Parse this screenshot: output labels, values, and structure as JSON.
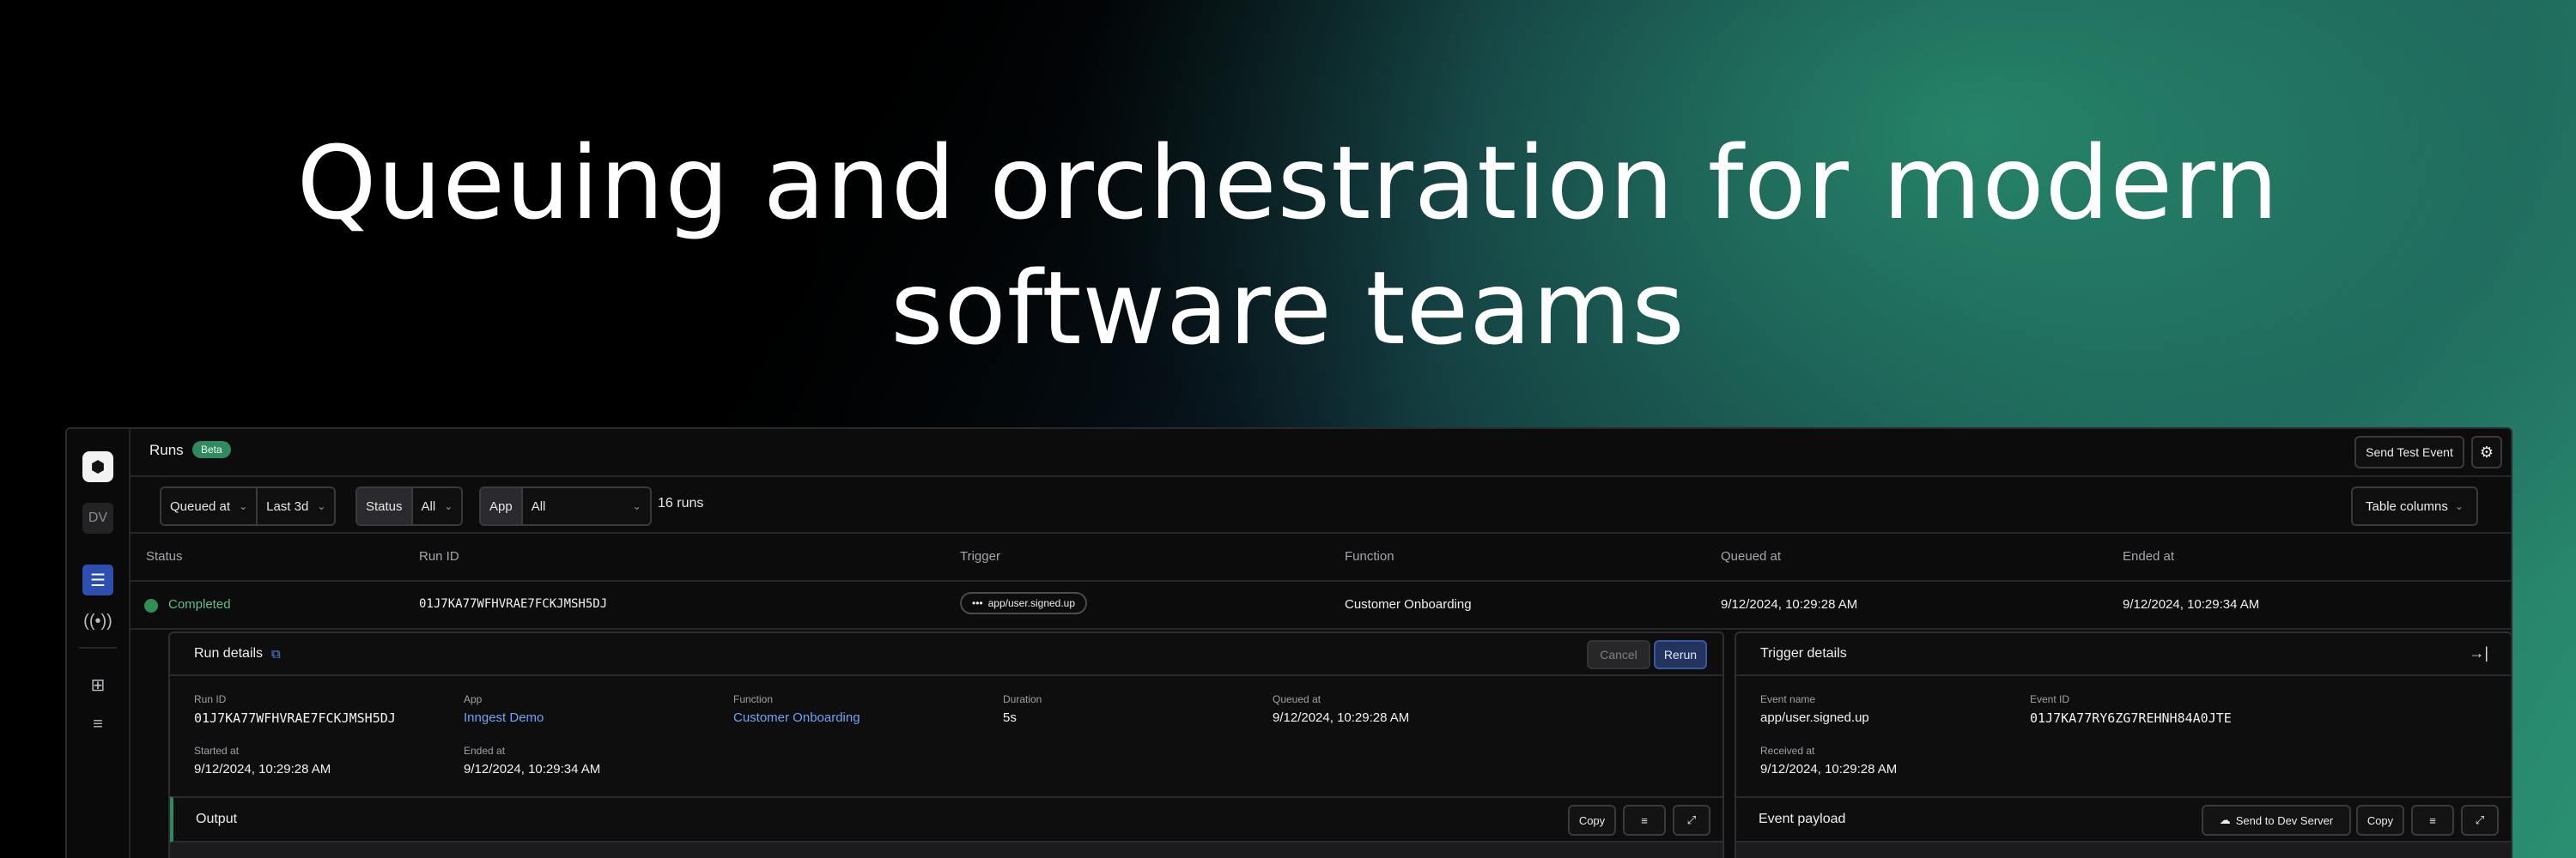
{
  "headline": {
    "line1": "Queuing and orchestration for modern",
    "line2": "software teams"
  },
  "sidebar": {
    "logo": "⬢",
    "avatar": "DV",
    "items": [
      "runs-icon",
      "events-icon",
      "apps-icon",
      "list-icon"
    ]
  },
  "topbar": {
    "title": "Runs",
    "badge": "Beta",
    "send_test_event": "Send Test Event",
    "settings_icon": "⚙"
  },
  "filters": {
    "queued_at_label": "Queued at",
    "time_range": "Last 3d",
    "status_label": "Status",
    "status_value": "All",
    "app_label": "App",
    "app_value": "All",
    "runs_count": "16 runs",
    "table_columns": "Table columns"
  },
  "table": {
    "headers": [
      "Status",
      "Run ID",
      "Trigger",
      "Function",
      "Queued at",
      "Ended at"
    ],
    "rows": [
      {
        "status": "Completed",
        "run_id": "01J7KA77WFHVRAE7FCKJMSH5DJ",
        "trigger": "app/user.signed.up",
        "function": "Customer Onboarding",
        "queued_at": "9/12/2024, 10:29:28 AM",
        "ended_at": "9/12/2024, 10:29:34 AM"
      }
    ]
  },
  "run_details": {
    "title": "Run details",
    "cancel": "Cancel",
    "rerun": "Rerun",
    "fields": {
      "run_id_k": "Run ID",
      "run_id_v": "01J7KA77WFHVRAE7FCKJMSH5DJ",
      "app_k": "App",
      "app_v": "Inngest Demo",
      "function_k": "Function",
      "function_v": "Customer Onboarding",
      "duration_k": "Duration",
      "duration_v": "5s",
      "queued_k": "Queued at",
      "queued_v": "9/12/2024, 10:29:28 AM",
      "started_k": "Started at",
      "started_v": "9/12/2024, 10:29:28 AM",
      "ended_k": "Ended at",
      "ended_v": "9/12/2024, 10:29:34 AM"
    },
    "output": {
      "title": "Output",
      "copy": "Copy"
    }
  },
  "trigger_details": {
    "title": "Trigger details",
    "fields": {
      "event_name_k": "Event name",
      "event_name_v": "app/user.signed.up",
      "event_id_k": "Event ID",
      "event_id_v": "01J7KA77RY6ZG7REHNH84A0JTE",
      "received_k": "Received at",
      "received_v": "9/12/2024, 10:29:28 AM"
    },
    "payload": {
      "title": "Event payload",
      "send_dev": "Send to Dev Server",
      "copy": "Copy"
    }
  }
}
